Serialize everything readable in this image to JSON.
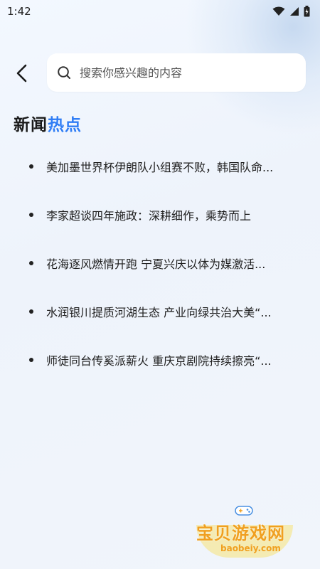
{
  "status_bar": {
    "time": "1:42",
    "icons": [
      "wifi-icon",
      "signal-icon",
      "battery-icon"
    ]
  },
  "search": {
    "placeholder": "搜索你感兴趣的内容",
    "icon": "search-icon"
  },
  "section": {
    "title_part1": "新闻",
    "title_part2": "热点",
    "accent_color": "#2f7df5"
  },
  "news": [
    "美加墨世界杯伊朗队小组赛不败，韩国队命...",
    "李家超谈四年施政：深耕细作，乘势而上",
    "花海逐风燃情开跑 宁夏兴庆以体为媒激活...",
    "水润银川提质河湖生态 产业向绿共治大美“...",
    "师徒同台传奚派薪火  重庆京剧院持续擦亮“..."
  ],
  "watermark": {
    "title": "宝贝游戏网",
    "url": "baobeiy.com",
    "icon": "gamepad-icon"
  }
}
